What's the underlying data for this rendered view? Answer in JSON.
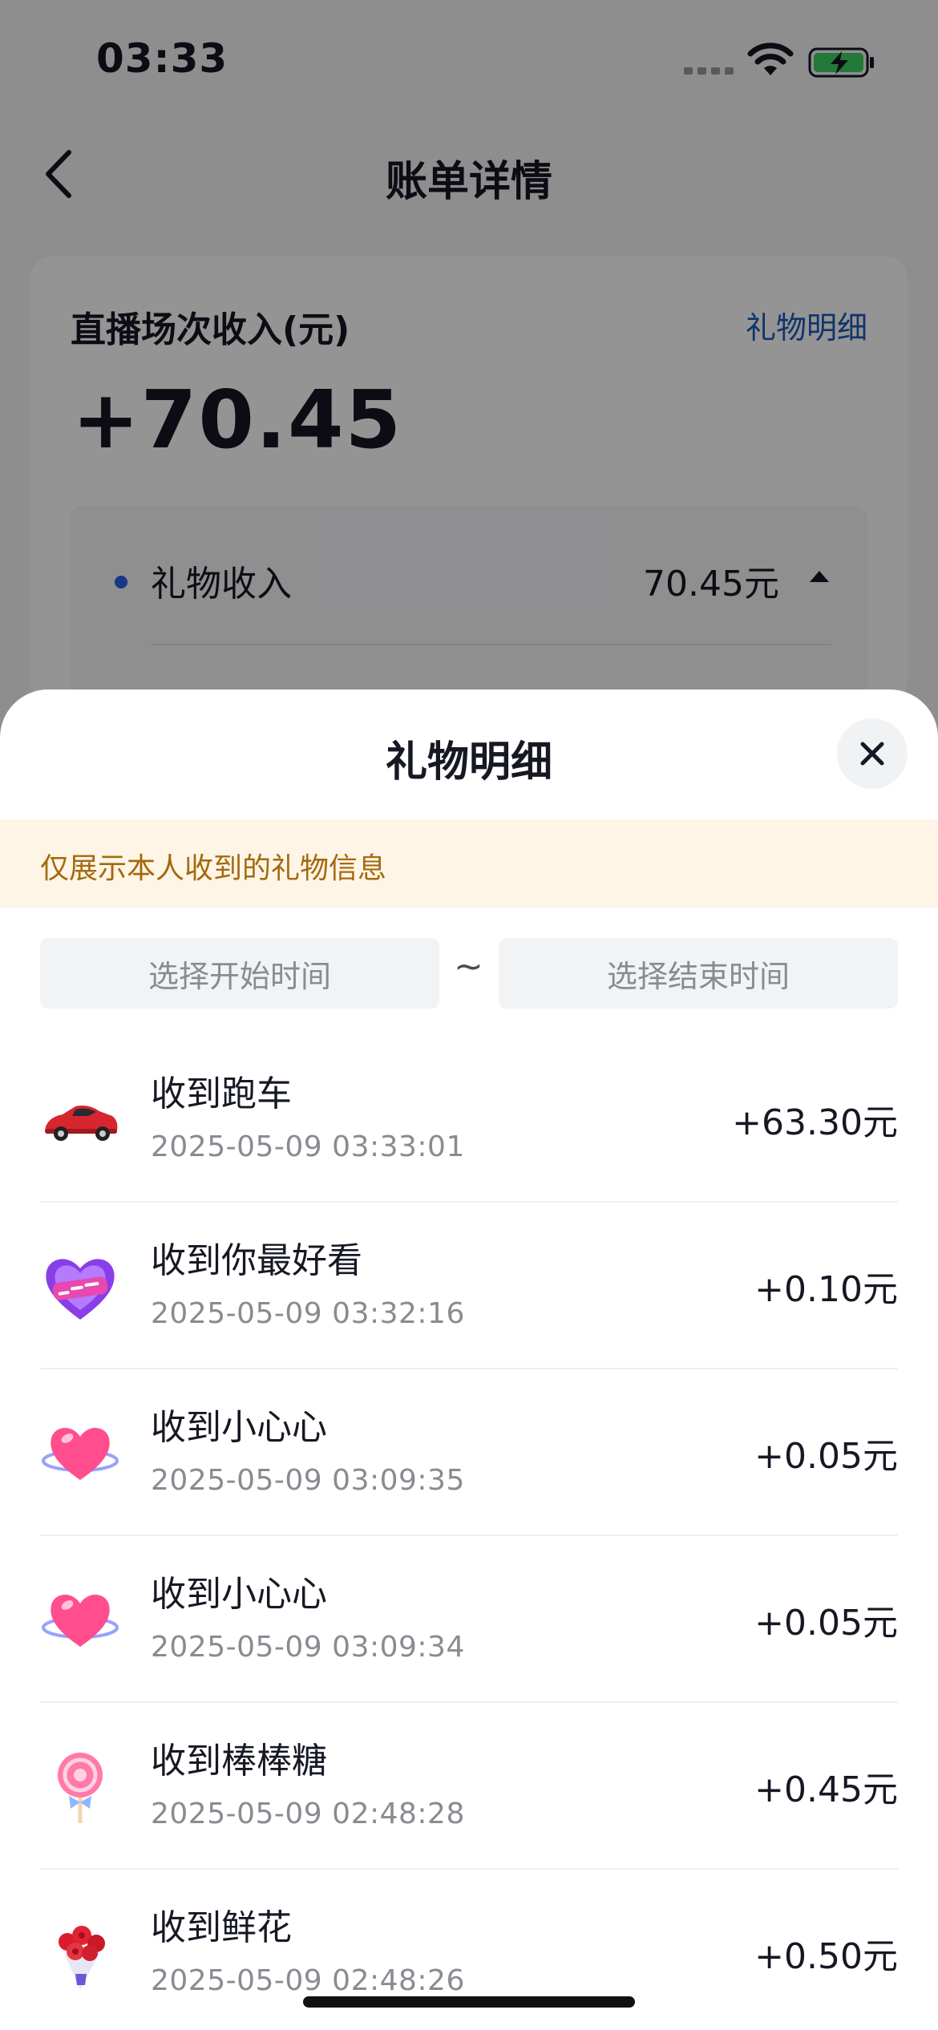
{
  "status": {
    "time": "03:33"
  },
  "nav": {
    "title": "账单详情"
  },
  "summary": {
    "label": "直播场次收入(元)",
    "link": "礼物明细",
    "amount": "+70.45",
    "income_label": "礼物收入",
    "income_value": "70.45元"
  },
  "sheet": {
    "title": "礼物明细",
    "notice": "仅展示本人收到的礼物信息",
    "start_placeholder": "选择开始时间",
    "end_placeholder": "选择结束时间",
    "separator": "~",
    "gifts": [
      {
        "name": "收到跑车",
        "time": "2025-05-09 03:33:01",
        "amount": "+63.30元",
        "icon": "sports-car-icon"
      },
      {
        "name": "收到你最好看",
        "time": "2025-05-09 03:32:16",
        "amount": "+0.10元",
        "icon": "heart-badge-icon"
      },
      {
        "name": "收到小心心",
        "time": "2025-05-09 03:09:35",
        "amount": "+0.05元",
        "icon": "heart-icon"
      },
      {
        "name": "收到小心心",
        "time": "2025-05-09 03:09:34",
        "amount": "+0.05元",
        "icon": "heart-icon"
      },
      {
        "name": "收到棒棒糖",
        "time": "2025-05-09 02:48:28",
        "amount": "+0.45元",
        "icon": "lollipop-icon"
      },
      {
        "name": "收到鲜花",
        "time": "2025-05-09 02:48:26",
        "amount": "+0.50元",
        "icon": "flower-bouquet-icon"
      }
    ]
  }
}
